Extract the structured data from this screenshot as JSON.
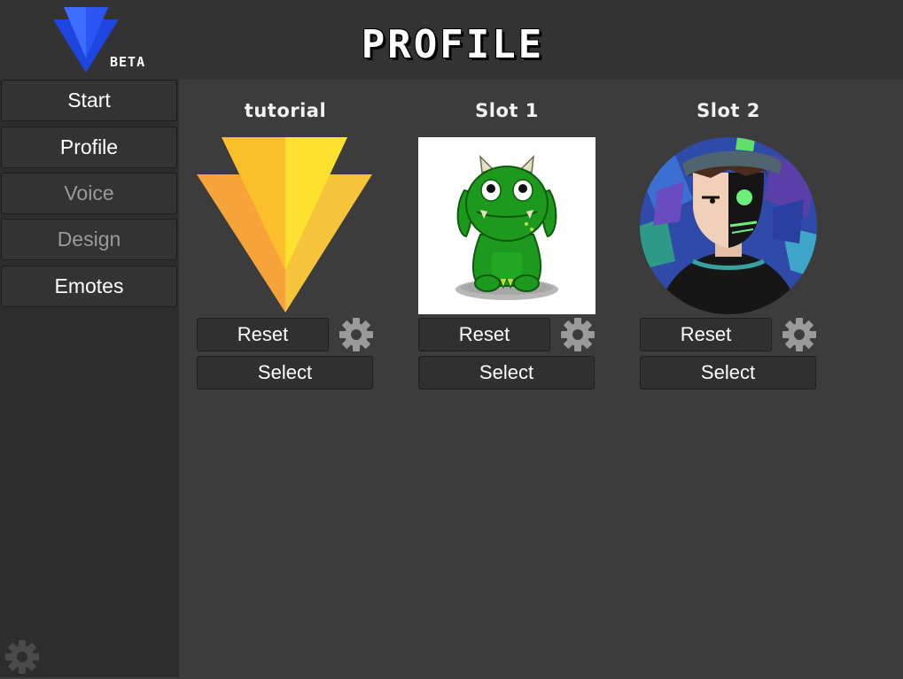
{
  "header": {
    "logo_badge": "BETA",
    "title": "PROFILE"
  },
  "sidebar": {
    "items": [
      {
        "label": "Start",
        "enabled": true
      },
      {
        "label": "Profile",
        "enabled": true
      },
      {
        "label": "Voice",
        "enabled": false
      },
      {
        "label": "Design",
        "enabled": false
      },
      {
        "label": "Emotes",
        "enabled": true
      }
    ],
    "settings_icon": "gear-icon"
  },
  "slots": [
    {
      "title": "tutorial",
      "avatar": "orange-triangle-logo",
      "reset_label": "Reset",
      "select_label": "Select",
      "settings_icon": "gear-icon"
    },
    {
      "title": "Slot 1",
      "avatar": "green-monster-drawing",
      "reset_label": "Reset",
      "select_label": "Select",
      "settings_icon": "gear-icon"
    },
    {
      "title": "Slot 2",
      "avatar": "round-character-portrait",
      "reset_label": "Reset",
      "select_label": "Select",
      "settings_icon": "gear-icon"
    }
  ],
  "colors": {
    "logo_blue": "#2f5bff",
    "tutorial_orange": "#f6a33a",
    "tutorial_yellow": "#fde12f",
    "monster_green": "#1d9a1d"
  }
}
